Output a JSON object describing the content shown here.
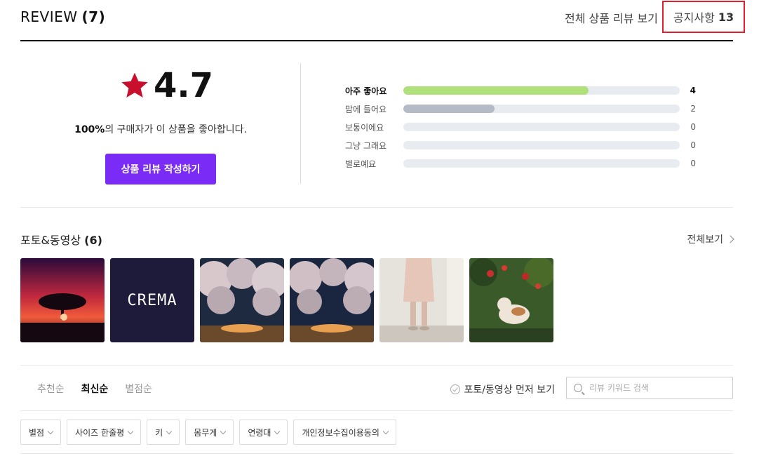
{
  "header": {
    "title": "REVIEW",
    "count": "(7)",
    "all_reviews_link": "전체 상품 리뷰 보기",
    "notice_label": "공지사항",
    "notice_count": "13"
  },
  "summary": {
    "score": "4.7",
    "satisfaction_pct": "100%",
    "satisfaction_text": "의 구매자가 이 상품을 좋아합니다.",
    "write_button": "상품 리뷰 작성하기",
    "star_color": "#c8102e",
    "button_color": "#7a2bf5"
  },
  "distribution": [
    {
      "label": "아주 좋아요",
      "count": "4",
      "fraction": 0.67,
      "color": "#b0e07a",
      "strong": true
    },
    {
      "label": "맘에 들어요",
      "count": "2",
      "fraction": 0.33,
      "color": "#b4bac6",
      "strong": false
    },
    {
      "label": "보통이에요",
      "count": "0",
      "fraction": 0,
      "color": "#b4bac6",
      "strong": false
    },
    {
      "label": "그냥 그래요",
      "count": "0",
      "fraction": 0,
      "color": "#b4bac6",
      "strong": false
    },
    {
      "label": "별로예요",
      "count": "0",
      "fraction": 0,
      "color": "#b4bac6",
      "strong": false
    }
  ],
  "media": {
    "title": "포토&동영상",
    "count": "(6)",
    "view_all": "전체보기",
    "crema_logo": "CREMA"
  },
  "sort": {
    "tabs": [
      "추천순",
      "최신순",
      "별점순"
    ],
    "active_tab": "최신순",
    "photo_first": "포토/동영상 먼저 보기",
    "search_placeholder": "리뷰 키워드 검색"
  },
  "filters": [
    "별점",
    "사이즈 한줄평",
    "키",
    "몸무게",
    "연령대",
    "개인정보수집이용동의"
  ]
}
